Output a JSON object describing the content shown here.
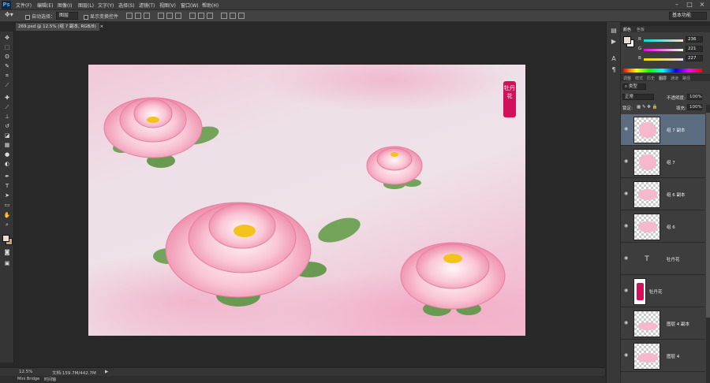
{
  "app": {
    "logo": "Ps",
    "menu": [
      "文件(F)",
      "编辑(E)",
      "图像(I)",
      "图层(L)",
      "文字(Y)",
      "选择(S)",
      "滤镜(T)",
      "视图(V)",
      "窗口(W)",
      "帮助(H)"
    ],
    "window_controls": [
      "–",
      "□",
      "×"
    ]
  },
  "options": {
    "auto_select_label": "自动选择：",
    "auto_select_value": "图层",
    "show_transform_label": "显示变换控件",
    "workspace": "基本功能"
  },
  "document": {
    "tab_title": "269.psd @ 12.5% (组 7 副本, RGB/8)",
    "tab_close": "×",
    "seal_text": "牡丹花"
  },
  "status": {
    "zoom": "12.5%",
    "doc_info": "文档:159.7M/442.7M",
    "arrow": "▶"
  },
  "bottom_tabs": [
    "Mini Bridge",
    "时间轴"
  ],
  "color_panel": {
    "tabs": [
      "颜色",
      "色板"
    ],
    "colors": {
      "foreground": "#ecddd3",
      "background": "#ffffff"
    },
    "channels": [
      {
        "label": "R",
        "value": "236"
      },
      {
        "label": "G",
        "value": "221"
      },
      {
        "label": "B",
        "value": "227"
      }
    ]
  },
  "layers_panel": {
    "tabs": [
      "调整",
      "样式",
      "历史",
      "图层",
      "通道",
      "路径"
    ],
    "filter_kind": "类型",
    "blend_mode": "正常",
    "opacity_label": "不透明度:",
    "opacity_value": "100%",
    "lock_label": "锁定:",
    "fill_label": "填充:",
    "fill_value": "100%",
    "layers": [
      {
        "name": "组 7 副本",
        "kind": "group",
        "selected": true
      },
      {
        "name": "组 7",
        "kind": "group",
        "selected": false
      },
      {
        "name": "组 6 副本",
        "kind": "group",
        "selected": false
      },
      {
        "name": "组 6",
        "kind": "group",
        "selected": false
      },
      {
        "name": "牡丹花",
        "kind": "text",
        "selected": false
      },
      {
        "name": "牡丹花",
        "kind": "shape",
        "selected": false
      },
      {
        "name": "图层 4 副本",
        "kind": "pixel",
        "selected": false
      },
      {
        "name": "图层 4",
        "kind": "pixel",
        "selected": false
      }
    ]
  },
  "icons": {
    "tools": [
      "move-icon",
      "marquee-icon",
      "lasso-icon",
      "quick-select-icon",
      "crop-icon",
      "eyedropper-icon",
      "healing-icon",
      "brush-icon",
      "stamp-icon",
      "history-brush-icon",
      "eraser-icon",
      "gradient-icon",
      "blur-icon",
      "dodge-icon",
      "pen-icon",
      "type-icon",
      "path-select-icon",
      "shape-icon",
      "hand-icon",
      "zoom-icon"
    ]
  }
}
